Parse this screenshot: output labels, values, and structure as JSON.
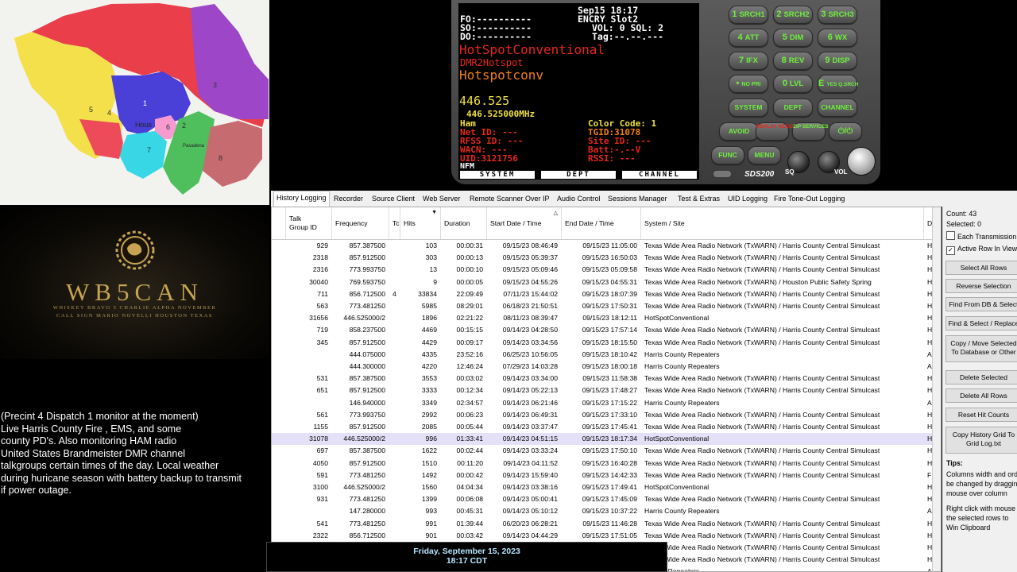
{
  "map": {
    "labels": [
      "Hous",
      "Pasadena"
    ],
    "precinct_numbers": [
      "1",
      "2",
      "3",
      "4",
      "5",
      "6",
      "7",
      "8"
    ],
    "colors": {
      "p1": "#4a3fd6",
      "p2": "#d44bd6",
      "p3": "#9d47c8",
      "p4": "#ee4b5a",
      "p5": "#f4e04a",
      "p6": "#f79ad0",
      "p7": "#38d7e6",
      "p8": "#c66b6f",
      "green": "#4fbf5e"
    }
  },
  "logo": {
    "title": "WB5CAN",
    "phonetic": "WHISKEY BRAVO 5 CHARLIE ALPHA NOVEMBER",
    "callsign": "CALL SIGN MARIO NOVELLI HOUSTON TEXAS"
  },
  "description": [
    "(Precint 4 Dispatch 1 monitor at the moment)",
    "Live Harris County Fire , EMS, and some",
    "county PD's. Also monitoring HAM radio",
    " United States Brandmeister DMR channel",
    "talkgroups certain times of the day. Local weather",
    "during huricane season with battery backup to transmit",
    "if power outage."
  ],
  "lcd": {
    "date": "Sep15 18:17",
    "fo": "FO:----------",
    "encry": "ENCRY Slot2",
    "so": "SO:----------",
    "vol": "VOL: 0 SQL: 2",
    "do": "DO:----------",
    "tag": "Tag:--.--.---",
    "system": "HotSpotConventional",
    "dept": "DMR2Hotspot",
    "channel": "Hotspotconv",
    "freq_big": "446.525",
    "freq": "446.525000MHz",
    "mode": "Ham",
    "color_code": "Color Code: 1",
    "net_id": "Net ID: ---",
    "tgid": "TGID:31078",
    "rfss_id": "RFSS ID: ---",
    "site_id": "Site ID: ---",
    "wacn": "WACN: ---",
    "batt": "Batt:-.--V",
    "uid": "UID:3121756",
    "rssi": "RSSI: ---",
    "modulation": "NFM",
    "bottom": [
      "SYSTEM",
      "DEPT",
      "CHANNEL"
    ]
  },
  "scanner": {
    "keys": [
      [
        {
          "n": "1",
          "t": "SRCH1"
        },
        {
          "n": "2",
          "t": "SRCH2"
        },
        {
          "n": "3",
          "t": "SRCH3"
        }
      ],
      [
        {
          "n": "4",
          "t": "ATT"
        },
        {
          "n": "5",
          "t": "DIM"
        },
        {
          "n": "6",
          "t": "WX"
        }
      ],
      [
        {
          "n": "7",
          "t": "IFX"
        },
        {
          "n": "8",
          "t": "REV"
        },
        {
          "n": "9",
          "t": "DISP"
        }
      ],
      [
        {
          "n": "•",
          "t": "NO PRI"
        },
        {
          "n": "0",
          "t": "LVL"
        },
        {
          "n": "E",
          "t": "YES Q.SRCH"
        }
      ],
      [
        {
          "n": "",
          "t": "SYSTEM"
        },
        {
          "n": "",
          "t": "DEPT"
        },
        {
          "n": "",
          "t": "CHANNEL"
        }
      ]
    ],
    "avoid": "AVOID",
    "replay": "REPLAY RECORD",
    "zip": "ZIP SERVICES",
    "power": "⏻/⏻",
    "func": "FUNC",
    "menu": "MENU",
    "model": "SDS200",
    "sq": "SQ",
    "vol": "VOL"
  },
  "tabs": [
    "History Logging",
    "Recorder",
    "Source Client",
    "Web Server",
    "Remote Scanner Over IP",
    "Audio Control",
    "Sessions Manager",
    "Test & Extras",
    "UID Logging",
    "Fire Tone-Out Logging"
  ],
  "grid": {
    "headers": [
      "Talk Group ID",
      "Frequency",
      "Tc",
      "Hits",
      "Duration",
      "Start Date / Time",
      "End Date / Time",
      "System / Site",
      "D"
    ],
    "rows": [
      [
        "929",
        "857.387500",
        "",
        "103",
        "00:00:31",
        "09/15/23  08:46:49",
        "09/15/23  11:05:00",
        "Texas Wide Area Radio Network (TxWARN) / Harris County Central Simulcast",
        "H"
      ],
      [
        "2318",
        "857.912500",
        "",
        "303",
        "00:00:13",
        "09/15/23  05:39:37",
        "09/15/23  16:50:03",
        "Texas Wide Area Radio Network (TxWARN) / Harris County Central Simulcast",
        "H"
      ],
      [
        "2316",
        "773.993750",
        "",
        "13",
        "00:00:10",
        "09/15/23  05:09:46",
        "09/15/23  05:09:58",
        "Texas Wide Area Radio Network (TxWARN) / Harris County Central Simulcast",
        "H"
      ],
      [
        "30040",
        "769.593750",
        "",
        "9",
        "00:00:05",
        "09/15/23  04:55:26",
        "09/15/23  04:55:31",
        "Texas Wide Area Radio Network (TxWARN) / Houston Public Safety Spring",
        "H"
      ],
      [
        "711",
        "856.712500",
        "4",
        "33834",
        "22:09:49",
        "07/11/23  15:44:02",
        "09/15/23  18:07:39",
        "Texas Wide Area Radio Network (TxWARN) / Harris County Central Simulcast",
        "H"
      ],
      [
        "563",
        "773.481250",
        "",
        "5985",
        "08:29:01",
        "06/18/23  21:50:51",
        "09/15/23  17:50:31",
        "Texas Wide Area Radio Network (TxWARN) / Harris County Central Simulcast",
        "H"
      ],
      [
        "31656",
        "446.525000/2",
        "",
        "1896",
        "02:21:22",
        "08/11/23  08:39:47",
        "09/15/23  18:12:11",
        "HotSpotConventional",
        "H"
      ],
      [
        "719",
        "858.237500",
        "",
        "4469",
        "00:15:15",
        "09/14/23  04:28:50",
        "09/15/23  17:57:14",
        "Texas Wide Area Radio Network (TxWARN) / Harris County Central Simulcast",
        "H"
      ],
      [
        "345",
        "857.912500",
        "",
        "4429",
        "00:09:17",
        "09/14/23  03:34:56",
        "09/15/23  18:15:50",
        "Texas Wide Area Radio Network (TxWARN) / Harris County Central Simulcast",
        "H"
      ],
      [
        "",
        "444.075000",
        "",
        "4335",
        "23:52:16",
        "06/25/23  10:56:05",
        "09/15/23  18:10:42",
        "Harris County Repeaters",
        "A"
      ],
      [
        "",
        "444.300000",
        "",
        "4220",
        "12:46:24",
        "07/29/23  14:03:28",
        "09/15/23  18:00:18",
        "Harris County Repeaters",
        "A"
      ],
      [
        "531",
        "857.387500",
        "",
        "3553",
        "00:03:02",
        "09/14/23  03:34:00",
        "09/15/23  11:58:38",
        "Texas Wide Area Radio Network (TxWARN) / Harris County Central Simulcast",
        "H"
      ],
      [
        "651",
        "857.912500",
        "",
        "3333",
        "00:12:34",
        "09/14/23  05:22:13",
        "09/15/23  17:48:27",
        "Texas Wide Area Radio Network (TxWARN) / Harris County Central Simulcast",
        "H"
      ],
      [
        "",
        "146.940000",
        "",
        "3349",
        "02:34:57",
        "09/14/23  06:21:46",
        "09/15/23  17:15:22",
        "Harris County Repeaters",
        "A"
      ],
      [
        "561",
        "773.993750",
        "",
        "2992",
        "00:06:23",
        "09/14/23  06:49:31",
        "09/15/23  17:33:10",
        "Texas Wide Area Radio Network (TxWARN) / Harris County Central Simulcast",
        "H"
      ],
      [
        "1155",
        "857.912500",
        "",
        "2085",
        "00:05:44",
        "09/14/23  03:37:47",
        "09/15/23  17:45:41",
        "Texas Wide Area Radio Network (TxWARN) / Harris County Central Simulcast",
        "H"
      ],
      [
        "31078",
        "446.525000/2",
        "",
        "996",
        "01:33:41",
        "09/14/23  04:51:15",
        "09/15/23  18:17:34",
        "HotSpotConventional",
        "H"
      ],
      [
        "697",
        "857.387500",
        "",
        "1622",
        "00:02:44",
        "09/14/23  03:33:24",
        "09/15/23  17:50:10",
        "Texas Wide Area Radio Network (TxWARN) / Harris County Central Simulcast",
        "H"
      ],
      [
        "4050",
        "857.912500",
        "",
        "1510",
        "00:11:20",
        "09/14/23  04:11:52",
        "09/15/23  16:40:28",
        "Texas Wide Area Radio Network (TxWARN) / Harris County Central Simulcast",
        "H"
      ],
      [
        "591",
        "773.481250",
        "",
        "1492",
        "00:00:42",
        "09/14/23  15:59:40",
        "09/15/23  14:42:33",
        "Texas Wide Area Radio Network (TxWARN) / Harris County Central Simulcast",
        "F"
      ],
      [
        "3100",
        "446.525000/2",
        "",
        "1560",
        "04:04:34",
        "09/14/23  03:38:16",
        "09/15/23  17:49:41",
        "HotSpotConventional",
        "H"
      ],
      [
        "931",
        "773.481250",
        "",
        "1399",
        "00:06:08",
        "09/14/23  05:00:41",
        "09/15/23  17:45:09",
        "Texas Wide Area Radio Network (TxWARN) / Harris County Central Simulcast",
        "H"
      ],
      [
        "",
        "147.280000",
        "",
        "993",
        "00:45:31",
        "09/14/23  05:10:12",
        "09/15/23  10:37:22",
        "Harris County Repeaters",
        "A"
      ],
      [
        "541",
        "773.481250",
        "",
        "991",
        "01:39:44",
        "06/20/23  06:28:21",
        "09/15/23  11:46:28",
        "Texas Wide Area Radio Network (TxWARN) / Harris County Central Simulcast",
        "H"
      ],
      [
        "2322",
        "856.712500",
        "",
        "901",
        "00:03:42",
        "09/14/23  04:44:29",
        "09/15/23  17:51:05",
        "Texas Wide Area Radio Network (TxWARN) / Harris County Central Simulcast",
        "H"
      ],
      [
        "",
        "",
        "",
        "",
        "",
        "",
        "",
        "Texas Wide Area Radio Network (TxWARN) / Harris County Central Simulcast",
        "H"
      ],
      [
        "",
        "",
        "",
        "",
        "",
        "",
        "",
        "Texas Wide Area Radio Network (TxWARN) / Harris County Central Simulcast",
        "H"
      ],
      [
        "",
        "",
        "",
        "",
        "",
        "",
        "",
        "County Repeaters",
        "A"
      ]
    ],
    "selected_row": 16
  },
  "rpanel": {
    "count": "Count:  43",
    "selected": "Selected:  0",
    "each_transmission": "Each Transmission",
    "active_row": "Active Row In View",
    "buttons": [
      "Select All Rows",
      "Reverse Selection",
      "Find From DB & Select",
      "Find & Select / Replace",
      "Copy / Move Selected To Database or Other",
      "Delete Selected",
      "Delete All Rows",
      "Reset Hit Counts",
      "Copy History Grid To Grid Log.txt"
    ],
    "tips_title": "Tips:",
    "tips": [
      "Columns width and order",
      "be changed by dragging",
      "mouse over column",
      "",
      "Right click with mouse",
      "the selected rows to",
      "Win Clipboard"
    ]
  },
  "datebox": {
    "date": "Friday, September 15, 2023",
    "time": "18:17 CDT"
  }
}
